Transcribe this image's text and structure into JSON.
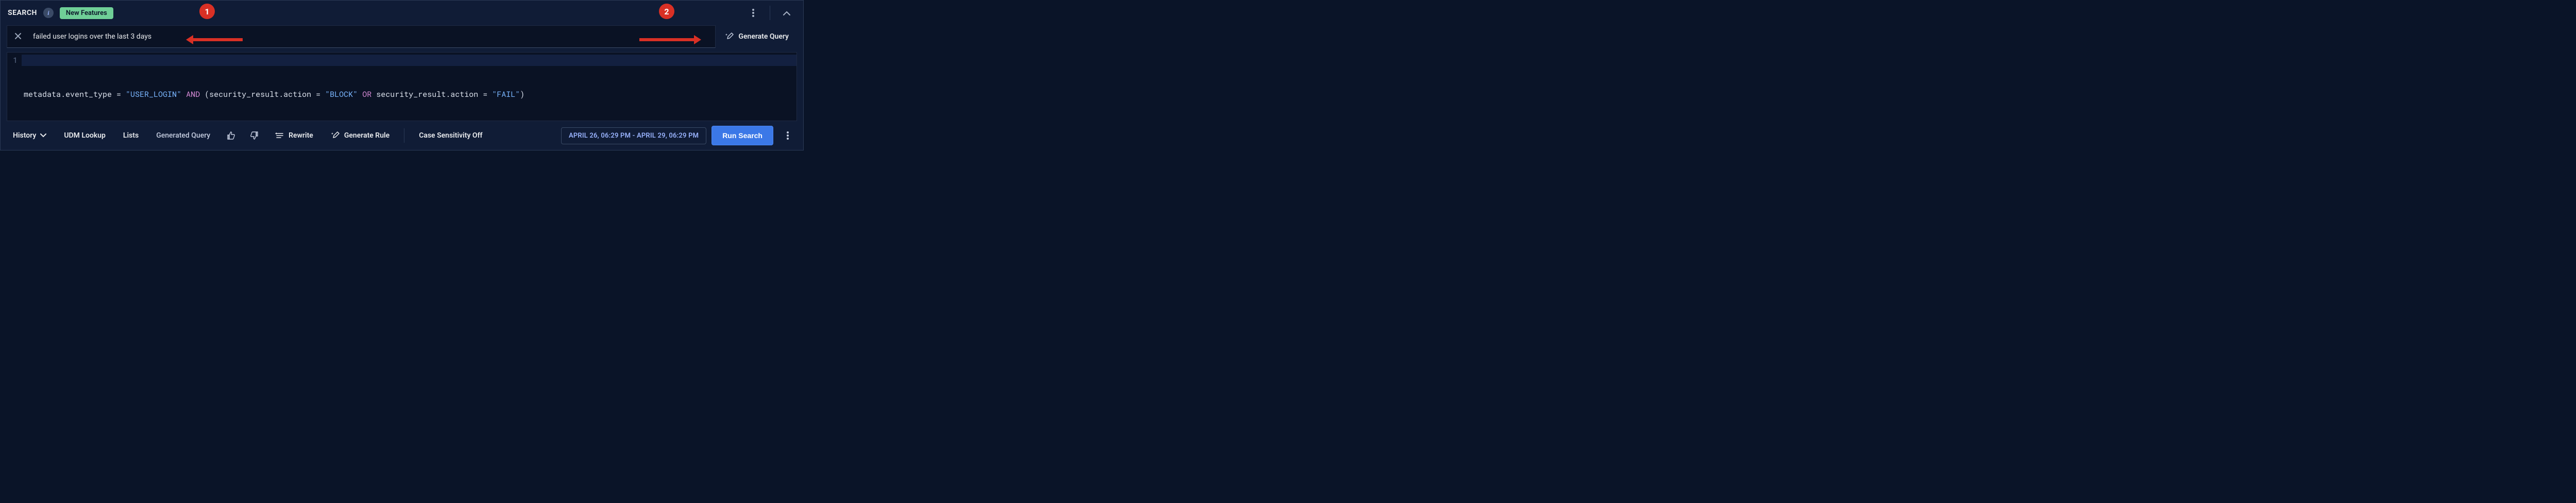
{
  "header": {
    "title": "SEARCH",
    "new_features": "New Features"
  },
  "nl": {
    "text": "failed user logins over the last 3 days",
    "generate": "Generate Query"
  },
  "editor": {
    "line_no": "1",
    "tokens": {
      "id1": "metadata.event_type",
      "eq": " = ",
      "str1": "\"USER_LOGIN\"",
      "and": " AND ",
      "lp": "(",
      "id2": "security_result.action",
      "str2": "\"BLOCK\"",
      "or": " OR ",
      "id3": "security_result.action",
      "str3": "\"FAIL\"",
      "rp": ")"
    }
  },
  "toolbar": {
    "history": "History",
    "udm": "UDM Lookup",
    "lists": "Lists",
    "gen_label": "Generated Query",
    "rewrite": "Rewrite",
    "gen_rule": "Generate Rule",
    "case_sens": "Case Sensitivity Off",
    "time_range": "APRIL 26, 06:29 PM - APRIL 29, 06:29 PM",
    "run": "Run Search"
  },
  "anno": {
    "n1": "1",
    "n2": "2"
  }
}
